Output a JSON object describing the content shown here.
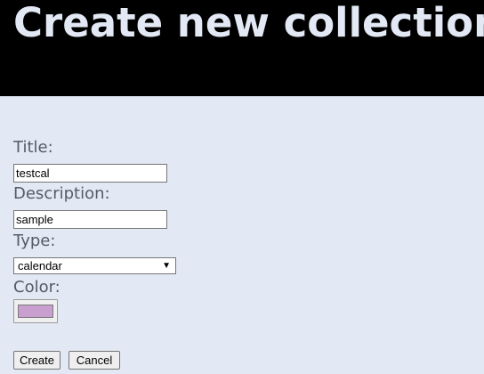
{
  "header": {
    "title": "Create new collection"
  },
  "form": {
    "title_label": "Title:",
    "title_value": "testcal",
    "description_label": "Description:",
    "description_value": "sample",
    "type_label": "Type:",
    "type_value": "calendar",
    "color_label": "Color:",
    "color_value": "#c89fcf"
  },
  "actions": {
    "create_label": "Create",
    "cancel_label": "Cancel"
  },
  "icons": {
    "select_arrow": "chevron-down-icon"
  },
  "colors": {
    "page_background": "#e2e8f4",
    "header_background": "#000000",
    "header_text": "#e2e8f4",
    "label_text": "#555c66"
  }
}
